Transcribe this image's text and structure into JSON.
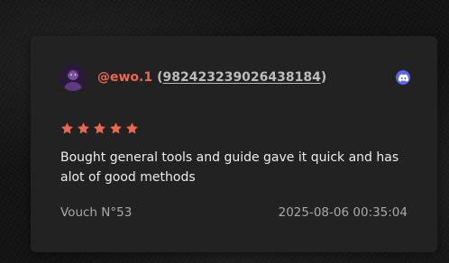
{
  "vouch": {
    "username": "@ewo.1",
    "user_id": "982423239026438184",
    "id_open": "(",
    "id_close": ")",
    "platform_icon": "discord-icon",
    "rating": 5,
    "rating_max": 5,
    "review_text": "Bought general tools and guide gave it quick and has alot of good methods",
    "vouch_label": "Vouch N°53",
    "timestamp": "2025-08-06 00:35:04"
  },
  "colors": {
    "username": "#f0664e",
    "star": "#f0664e",
    "card_bg": "#222222",
    "discord": "#5865f2"
  }
}
